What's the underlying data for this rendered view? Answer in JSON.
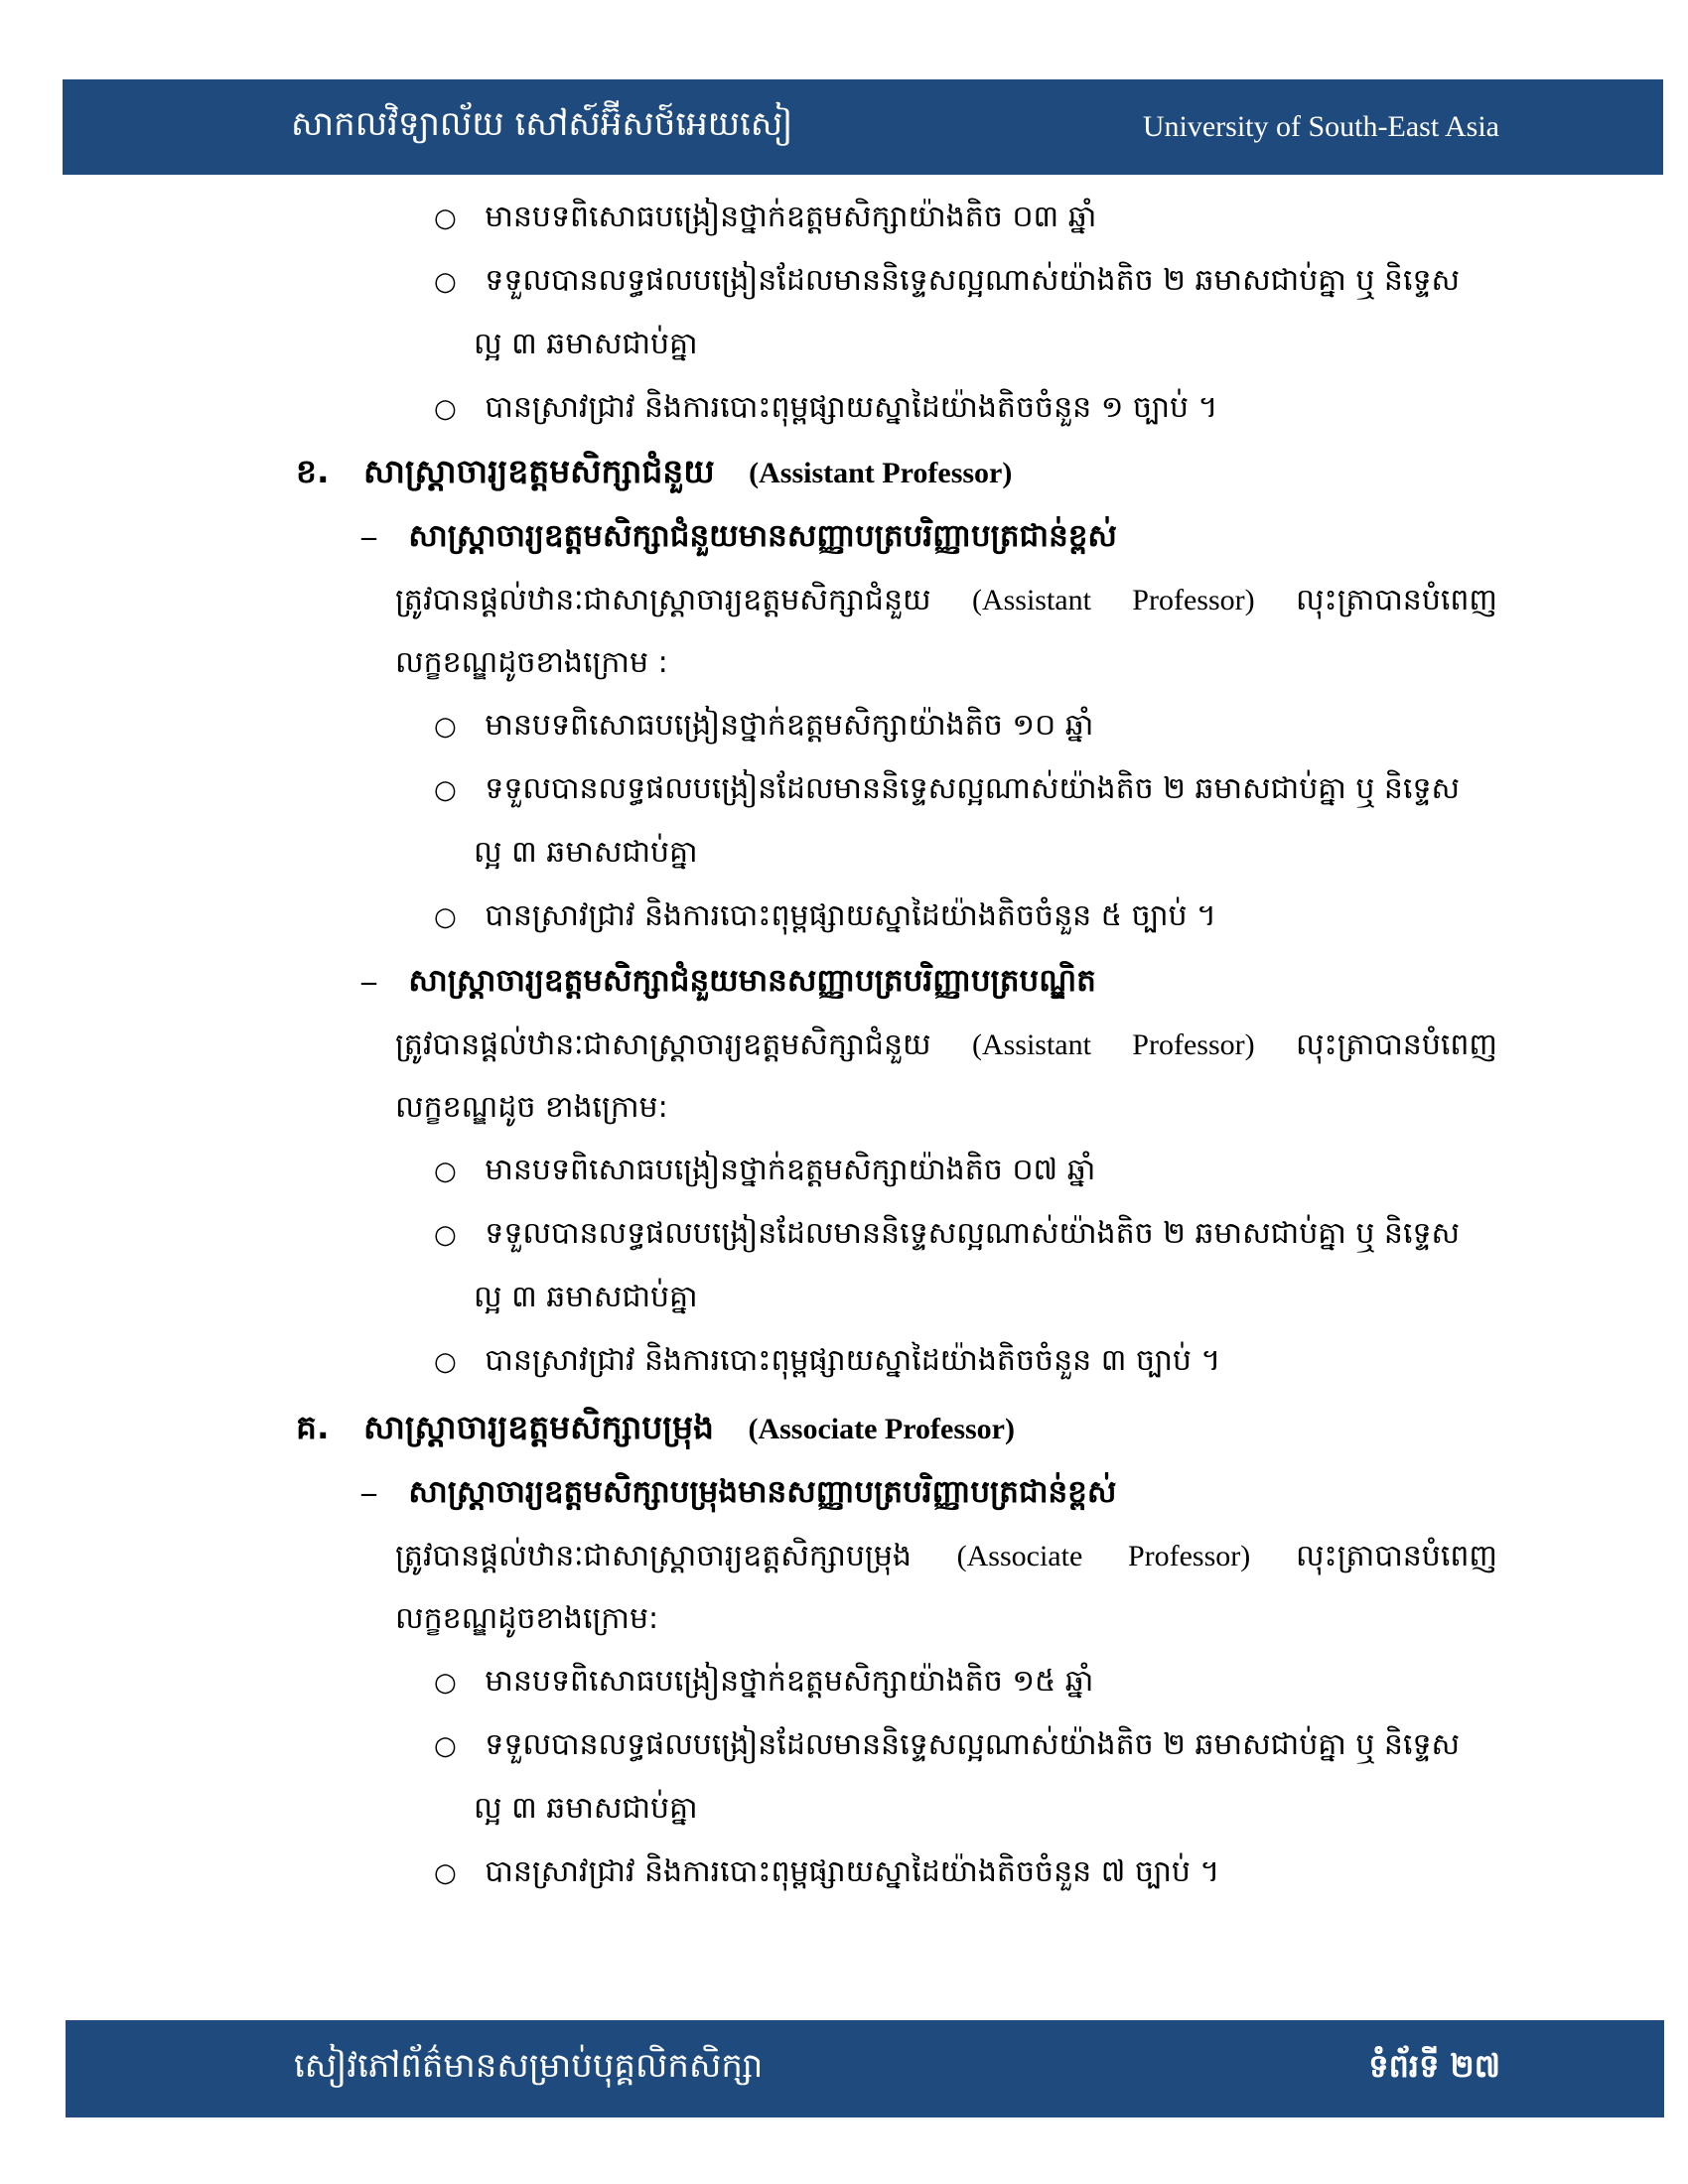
{
  "header": {
    "kh_title": "សាកលវិទ្យាល័យ សៅស៍អ៊ីសថ៍អេយសៀ",
    "en_title": "University of South-East Asia"
  },
  "footer": {
    "handbook": "សៀវភៅព័ត៌មានសម្រាប់បុគ្គលិកសិក្សា",
    "page": "ទំព័រទី ២៧"
  },
  "bullet_glyph": "○",
  "dash_glyph": "–",
  "top_items": [
    "មានបទពិសោធបង្រៀនថ្នាក់ឧត្តមសិក្សាយ៉ាងតិច ០៣ ឆ្នាំ",
    "ទទួលបានលទ្ធផលបង្រៀនដែលមាននិទ្ទេសល្អណាស់យ៉ាងតិច ២ ឆមាសជាប់គ្នា ឬ និទ្ទេស",
    "ល្អ ៣ ឆមាសជាប់គ្នា",
    "បានស្រាវជ្រាវ និងការបោះពុម្ពផ្សាយស្នាដៃយ៉ាងតិចចំនួន ១ ច្បាប់ ។"
  ],
  "section_kh": {
    "num": "ខ.",
    "title": "សាស្ត្រាចារ្យឧត្តមសិក្សាជំនួយ",
    "en": "(Assistant Professor)",
    "sub1": {
      "title": "សាស្ត្រាចារ្យឧត្តមសិក្សាជំនួយមានសញ្ញាបត្របរិញ្ញាបត្រជាន់ខ្ពស់",
      "para_kh": "ត្រូវបានផ្តល់ឋានៈជាសាស្ត្រាចារ្យឧត្តមសិក្សាជំនួយ",
      "para_en": "(Assistant",
      "para_en2": "Professor)",
      "para_tail": "លុះត្រាបានបំពេញ",
      "para2": "លក្ខខណ្ឌដូចខាងក្រោម :",
      "items": [
        "មានបទពិសោធបង្រៀនថ្នាក់ឧត្តមសិក្សាយ៉ាងតិច ១០ ឆ្នាំ",
        "ទទួលបានលទ្ធផលបង្រៀនដែលមាននិទ្ទេសល្អណាស់យ៉ាងតិច ២ ឆមាសជាប់គ្នា ឬ និទ្ទេស",
        "ល្អ ៣ ឆមាសជាប់គ្នា",
        "បានស្រាវជ្រាវ និងការបោះពុម្ពផ្សាយស្នាដៃយ៉ាងតិចចំនួន ៥ ច្បាប់ ។"
      ]
    },
    "sub2": {
      "title": "សាស្ត្រាចារ្យឧត្តមសិក្សាជំនួយមានសញ្ញាបត្របរិញ្ញាបត្របណ្ឌិត",
      "para_kh": "ត្រូវបានផ្តល់ឋានៈជាសាស្ត្រាចារ្យឧត្តមសិក្សាជំនួយ",
      "para_en": "(Assistant",
      "para_en2": "Professor)",
      "para_tail": "លុះត្រាបានបំពេញ",
      "para2": "លក្ខខណ្ឌដូច ខាងក្រោម:",
      "items": [
        "មានបទពិសោធបង្រៀនថ្នាក់ឧត្តមសិក្សាយ៉ាងតិច ០៧ ឆ្នាំ",
        "ទទួលបានលទ្ធផលបង្រៀនដែលមាននិទ្ទេសល្អណាស់យ៉ាងតិច ២ ឆមាសជាប់គ្នា ឬ និទ្ទេស",
        "ល្អ ៣ ឆមាសជាប់គ្នា",
        "បានស្រាវជ្រាវ និងការបោះពុម្ពផ្សាយស្នាដៃយ៉ាងតិចចំនួន ៣ ច្បាប់ ។"
      ]
    }
  },
  "section_k": {
    "num": "គ.",
    "title": "សាស្ត្រាចារ្យឧត្តមសិក្សាបម្រុង",
    "en": "(Associate Professor)",
    "sub1": {
      "title": "សាស្ត្រាចារ្យឧត្តមសិក្សាបម្រុងមានសញ្ញាបត្របរិញ្ញាបត្រជាន់ខ្ពស់",
      "para_kh": "ត្រូវបានផ្តល់ឋានៈជាសាស្ត្រាចារ្យឧត្តសិក្សាបម្រុង",
      "para_en": "(Associate",
      "para_en2": "Professor)",
      "para_tail": "លុះត្រាបានបំពេញ",
      "para2": "លក្ខខណ្ឌដូចខាងក្រោម:",
      "items": [
        "មានបទពិសោធបង្រៀនថ្នាក់ឧត្តមសិក្សាយ៉ាងតិច ១៥ ឆ្នាំ",
        "ទទួលបានលទ្ធផលបង្រៀនដែលមាននិទ្ទេសល្អណាស់យ៉ាងតិច ២ ឆមាសជាប់គ្នា ឬ និទ្ទេស",
        "ល្អ ៣ ឆមាសជាប់គ្នា",
        "បានស្រាវជ្រាវ និងការបោះពុម្ពផ្សាយស្នាដៃយ៉ាងតិចចំនួន ៧ ច្បាប់ ។"
      ]
    }
  }
}
